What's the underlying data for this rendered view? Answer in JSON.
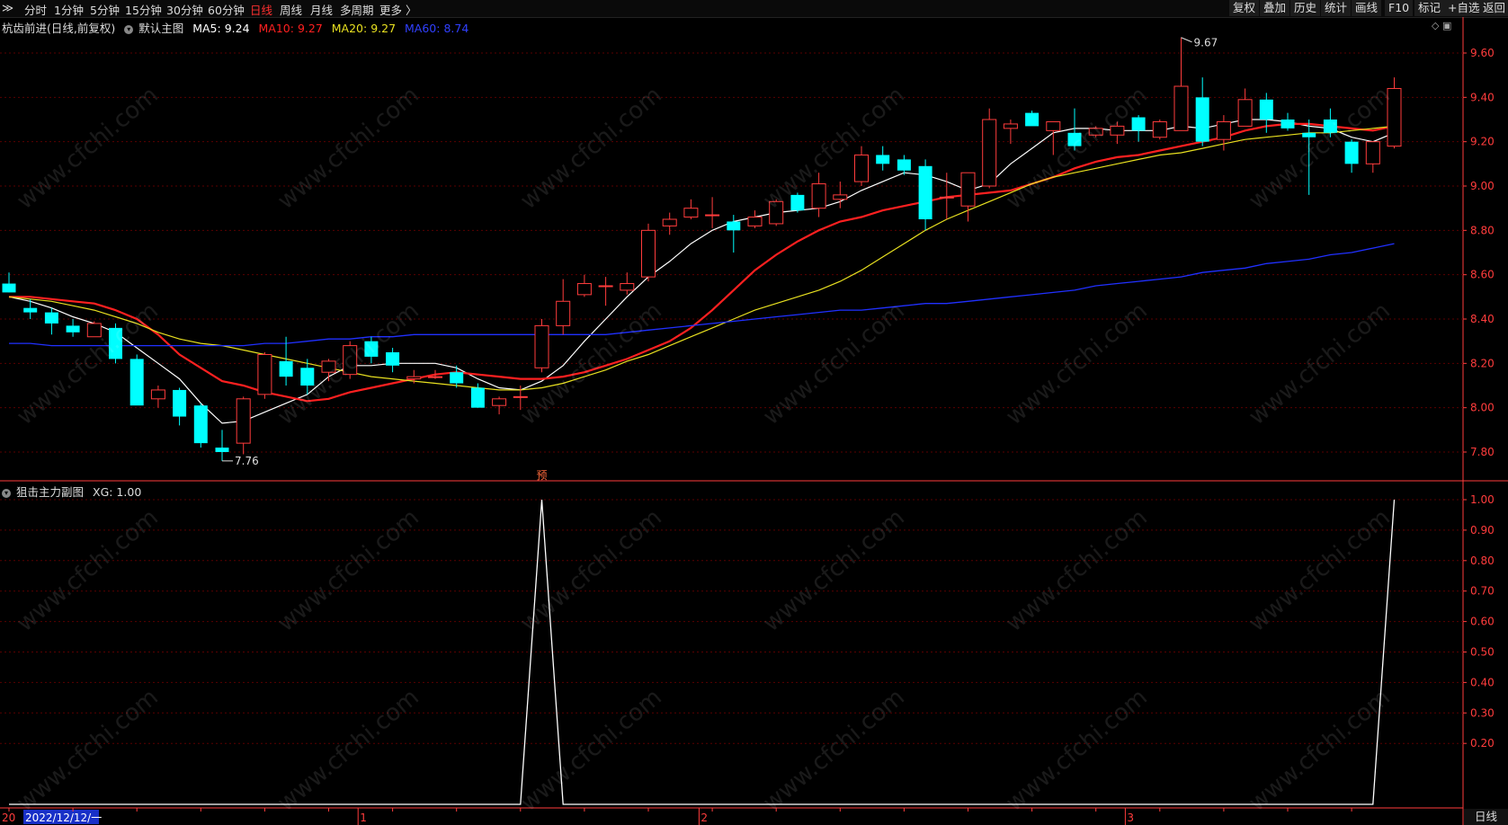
{
  "toolbar": {
    "menu_icon": "≫",
    "periods": [
      "分时",
      "1分钟",
      "5分钟",
      "15分钟",
      "30分钟",
      "60分钟",
      "日线",
      "周线",
      "月线",
      "多周期",
      "更多 〉"
    ],
    "active_period": "日线",
    "right_buttons": [
      "复权",
      "叠加",
      "历史",
      "统计",
      "画线",
      "F10",
      "标记",
      "+自选",
      "返回"
    ]
  },
  "main_header": {
    "title": "杭齿前进(日线,前复权)",
    "indicator_name": "默认主图",
    "ma5": "MA5: 9.24",
    "ma10": "MA10: 9.27",
    "ma20": "MA20: 9.27",
    "ma60": "MA60: 8.74"
  },
  "sub_header": {
    "indicator_name": "狙击主力副图",
    "xg": "XG: 1.00"
  },
  "corner_icons": "◇ ▣",
  "period_tab": "日线",
  "watermark_text": "www.cfchi.com",
  "colors": {
    "up": "#ff3c3c",
    "down": "#00ffff",
    "ma5": "#ffffff",
    "ma10": "#ff2020",
    "ma20": "#e8e020",
    "ma60": "#2030ff",
    "grid": "#5a0000",
    "axis": "#ff3c3c"
  },
  "chart_data": [
    {
      "type": "candlestick",
      "ylim": [
        7.68,
        9.72
      ],
      "yticks": [
        7.8,
        8.0,
        8.2,
        8.4,
        8.6,
        8.8,
        9.0,
        9.2,
        9.4,
        9.6
      ],
      "ytick_labels": [
        "7.80",
        "8.00",
        "8.20",
        "8.40",
        "8.60",
        "8.80",
        "9.00",
        "9.20",
        "9.40",
        "9.60"
      ],
      "annotations": {
        "high": "9.67",
        "low": "7.76",
        "pre_marker": "预"
      },
      "ohlc": [
        [
          8.56,
          8.61,
          8.52,
          8.52
        ],
        [
          8.45,
          8.49,
          8.4,
          8.43
        ],
        [
          8.43,
          8.45,
          8.33,
          8.38
        ],
        [
          8.37,
          8.4,
          8.32,
          8.34
        ],
        [
          8.32,
          8.39,
          8.32,
          8.38
        ],
        [
          8.36,
          8.38,
          8.2,
          8.22
        ],
        [
          8.22,
          8.24,
          8.02,
          8.01
        ],
        [
          8.04,
          8.1,
          8.0,
          8.08
        ],
        [
          8.08,
          8.09,
          7.92,
          7.96
        ],
        [
          8.01,
          8.02,
          7.82,
          7.84
        ],
        [
          7.82,
          7.9,
          7.76,
          7.8
        ],
        [
          7.84,
          8.05,
          7.79,
          8.04
        ],
        [
          8.06,
          8.25,
          8.04,
          8.24
        ],
        [
          8.21,
          8.32,
          8.1,
          8.14
        ],
        [
          8.18,
          8.22,
          8.06,
          8.1
        ],
        [
          8.16,
          8.22,
          8.12,
          8.21
        ],
        [
          8.15,
          8.3,
          8.13,
          8.28
        ],
        [
          8.3,
          8.32,
          8.2,
          8.23
        ],
        [
          8.25,
          8.27,
          8.16,
          8.19
        ],
        [
          8.13,
          8.17,
          8.11,
          8.14
        ],
        [
          8.14,
          8.17,
          8.13,
          8.14
        ],
        [
          8.16,
          8.19,
          8.09,
          8.11
        ],
        [
          8.09,
          8.11,
          8.0,
          8.0
        ],
        [
          8.01,
          8.05,
          7.97,
          8.04
        ],
        [
          8.05,
          8.1,
          7.99,
          8.05
        ],
        [
          8.18,
          8.4,
          8.16,
          8.37
        ],
        [
          8.37,
          8.58,
          8.33,
          8.48
        ],
        [
          8.51,
          8.6,
          8.5,
          8.56
        ],
        [
          8.55,
          8.59,
          8.46,
          8.55
        ],
        [
          8.53,
          8.61,
          8.51,
          8.56
        ],
        [
          8.59,
          8.83,
          8.57,
          8.8
        ],
        [
          8.82,
          8.88,
          8.78,
          8.85
        ],
        [
          8.86,
          8.94,
          8.85,
          8.9
        ],
        [
          8.87,
          8.95,
          8.81,
          8.87
        ],
        [
          8.84,
          8.87,
          8.7,
          8.8
        ],
        [
          8.82,
          8.89,
          8.81,
          8.86
        ],
        [
          8.83,
          8.94,
          8.82,
          8.93
        ],
        [
          8.96,
          8.97,
          8.88,
          8.89
        ],
        [
          8.9,
          9.06,
          8.86,
          9.01
        ],
        [
          8.94,
          9.02,
          8.9,
          8.96
        ],
        [
          9.02,
          9.18,
          9.0,
          9.14
        ],
        [
          9.14,
          9.18,
          9.07,
          9.1
        ],
        [
          9.12,
          9.14,
          9.05,
          9.07
        ],
        [
          9.09,
          9.12,
          8.8,
          8.85
        ],
        [
          8.95,
          9.06,
          8.85,
          8.95
        ],
        [
          8.91,
          9.06,
          8.84,
          9.06
        ],
        [
          9.0,
          9.35,
          8.99,
          9.3
        ],
        [
          9.26,
          9.3,
          9.19,
          9.28
        ],
        [
          9.33,
          9.34,
          9.28,
          9.27
        ],
        [
          9.25,
          9.28,
          9.14,
          9.29
        ],
        [
          9.24,
          9.35,
          9.16,
          9.18
        ],
        [
          9.23,
          9.27,
          9.22,
          9.26
        ],
        [
          9.23,
          9.29,
          9.19,
          9.27
        ],
        [
          9.31,
          9.32,
          9.2,
          9.25
        ],
        [
          9.22,
          9.3,
          9.21,
          9.29
        ],
        [
          9.25,
          9.67,
          9.25,
          9.45
        ],
        [
          9.4,
          9.49,
          9.18,
          9.2
        ],
        [
          9.21,
          9.32,
          9.16,
          9.29
        ],
        [
          9.27,
          9.44,
          9.27,
          9.39
        ],
        [
          9.39,
          9.42,
          9.24,
          9.3
        ],
        [
          9.3,
          9.33,
          9.25,
          9.26
        ],
        [
          9.24,
          9.3,
          8.96,
          9.22
        ],
        [
          9.3,
          9.35,
          9.22,
          9.24
        ],
        [
          9.2,
          9.21,
          9.06,
          9.1
        ],
        [
          9.1,
          9.18,
          9.06,
          9.2
        ],
        [
          9.18,
          9.49,
          9.17,
          9.44
        ]
      ],
      "series": [
        {
          "name": "MA5",
          "values": [
            8.5,
            8.48,
            8.45,
            8.41,
            8.38,
            8.34,
            8.27,
            8.2,
            8.13,
            8.02,
            7.93,
            7.94,
            7.98,
            8.02,
            8.06,
            8.14,
            8.19,
            8.19,
            8.2,
            8.2,
            8.2,
            8.18,
            8.13,
            8.09,
            8.08,
            8.12,
            8.19,
            8.3,
            8.4,
            8.5,
            8.59,
            8.66,
            8.74,
            8.8,
            8.84,
            8.86,
            8.88,
            8.89,
            8.9,
            8.93,
            8.98,
            9.02,
            9.06,
            9.05,
            9.02,
            8.98,
            9.01,
            9.1,
            9.17,
            9.24,
            9.26,
            9.26,
            9.25,
            9.25,
            9.25,
            9.27,
            9.26,
            9.28,
            9.3,
            9.3,
            9.29,
            9.27,
            9.26,
            9.22,
            9.2,
            9.24
          ]
        },
        {
          "name": "MA10",
          "values": [
            8.5,
            8.5,
            8.49,
            8.48,
            8.47,
            8.44,
            8.4,
            8.33,
            8.24,
            8.18,
            8.12,
            8.1,
            8.07,
            8.05,
            8.03,
            8.04,
            8.07,
            8.09,
            8.11,
            8.13,
            8.15,
            8.16,
            8.15,
            8.14,
            8.13,
            8.13,
            8.14,
            8.16,
            8.19,
            8.22,
            8.26,
            8.3,
            8.36,
            8.44,
            8.53,
            8.62,
            8.69,
            8.75,
            8.8,
            8.84,
            8.86,
            8.89,
            8.91,
            8.93,
            8.95,
            8.96,
            8.97,
            8.98,
            9.01,
            9.04,
            9.08,
            9.11,
            9.13,
            9.14,
            9.16,
            9.18,
            9.2,
            9.22,
            9.25,
            9.27,
            9.28,
            9.28,
            9.27,
            9.26,
            9.25,
            9.27
          ]
        },
        {
          "name": "MA20",
          "values": [
            8.5,
            8.49,
            8.48,
            8.46,
            8.44,
            8.41,
            8.38,
            8.34,
            8.31,
            8.29,
            8.28,
            8.26,
            8.24,
            8.22,
            8.2,
            8.18,
            8.16,
            8.14,
            8.13,
            8.12,
            8.11,
            8.1,
            8.09,
            8.08,
            8.08,
            8.09,
            8.11,
            8.14,
            8.17,
            8.21,
            8.24,
            8.28,
            8.32,
            8.36,
            8.4,
            8.44,
            8.47,
            8.5,
            8.53,
            8.57,
            8.62,
            8.68,
            8.74,
            8.8,
            8.85,
            8.89,
            8.93,
            8.97,
            9.01,
            9.04,
            9.06,
            9.08,
            9.1,
            9.12,
            9.14,
            9.15,
            9.17,
            9.19,
            9.21,
            9.22,
            9.23,
            9.24,
            9.24,
            9.25,
            9.26,
            9.27
          ]
        },
        {
          "name": "MA60",
          "values": [
            8.29,
            8.29,
            8.28,
            8.28,
            8.28,
            8.28,
            8.28,
            8.28,
            8.28,
            8.28,
            8.28,
            8.28,
            8.29,
            8.29,
            8.3,
            8.31,
            8.31,
            8.32,
            8.32,
            8.33,
            8.33,
            8.33,
            8.33,
            8.33,
            8.33,
            8.33,
            8.33,
            8.33,
            8.33,
            8.34,
            8.35,
            8.36,
            8.37,
            8.38,
            8.39,
            8.4,
            8.41,
            8.42,
            8.43,
            8.44,
            8.44,
            8.45,
            8.46,
            8.47,
            8.47,
            8.48,
            8.49,
            8.5,
            8.51,
            8.52,
            8.53,
            8.55,
            8.56,
            8.57,
            8.58,
            8.59,
            8.61,
            8.62,
            8.63,
            8.65,
            8.66,
            8.67,
            8.69,
            8.7,
            8.72,
            8.74
          ]
        }
      ]
    },
    {
      "type": "line",
      "ylim": [
        0,
        1.06
      ],
      "yticks": [
        0.2,
        0.3,
        0.4,
        0.5,
        0.6,
        0.7,
        0.8,
        0.9,
        1.0
      ],
      "ytick_labels": [
        "0.20",
        "0.30",
        "0.40",
        "0.50",
        "0.60",
        "0.70",
        "0.80",
        "0.90",
        "1.00"
      ],
      "series": [
        {
          "name": "XG",
          "values": [
            0,
            0,
            0,
            0,
            0,
            0,
            0,
            0,
            0,
            0,
            0,
            0,
            0,
            0,
            0,
            0,
            0,
            0,
            0,
            0,
            0,
            0,
            0,
            0,
            0,
            1,
            0,
            0,
            0,
            0,
            0,
            0,
            0,
            0,
            0,
            0,
            0,
            0,
            0,
            0,
            0,
            0,
            0,
            0,
            0,
            0,
            0,
            0,
            0,
            0,
            0,
            0,
            0,
            0,
            0,
            0,
            0,
            0,
            0,
            0,
            0,
            0,
            0,
            0,
            0,
            1
          ]
        }
      ]
    }
  ],
  "x_axis": {
    "date_label": "2022/12/12/一",
    "start_label": "20",
    "month_labels": [
      {
        "index": 16,
        "label": "1"
      },
      {
        "index": 32,
        "label": "2"
      },
      {
        "index": 52,
        "label": "3"
      }
    ]
  }
}
